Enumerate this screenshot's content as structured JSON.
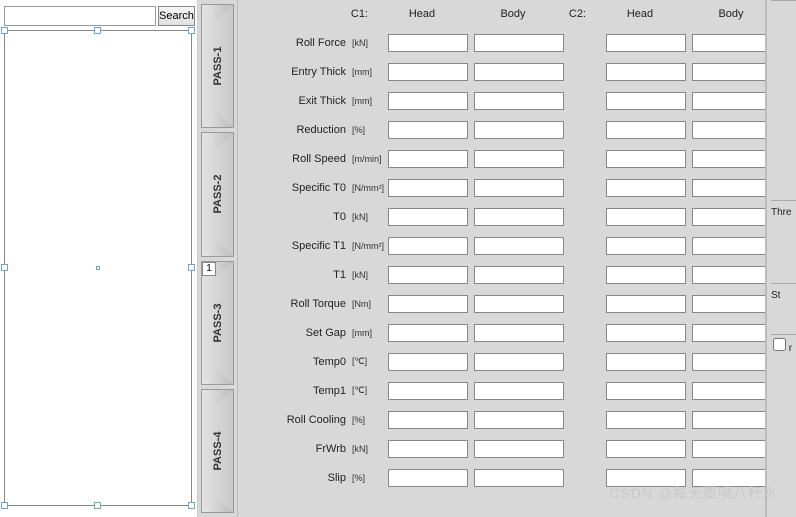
{
  "search": {
    "btn_label": "Search",
    "placeholder": ""
  },
  "page_indicator": "1",
  "pass_tabs": [
    "PASS-1",
    "PASS-2",
    "PASS-3",
    "PASS-4"
  ],
  "columns": {
    "c1": "C1:",
    "c2": "C2:",
    "head": "Head",
    "body": "Body"
  },
  "rows": [
    {
      "label": "Roll Force",
      "unit": "[kN]"
    },
    {
      "label": "Entry Thick",
      "unit": "[mm]"
    },
    {
      "label": "Exit Thick",
      "unit": "[mm]"
    },
    {
      "label": "Reduction",
      "unit": "[%]"
    },
    {
      "label": "Roll Speed",
      "unit": "[m/min]"
    },
    {
      "label": "Specific T0",
      "unit": "[N/mm²]"
    },
    {
      "label": "T0",
      "unit": "[kN]"
    },
    {
      "label": "Specific T1",
      "unit": "[N/mm²]"
    },
    {
      "label": "T1",
      "unit": "[kN]"
    },
    {
      "label": "Roll Torque",
      "unit": "[Nm]"
    },
    {
      "label": "Set Gap",
      "unit": "[mm]"
    },
    {
      "label": "Temp0",
      "unit": "[℃]"
    },
    {
      "label": "Temp1",
      "unit": "[℃]"
    },
    {
      "label": "Roll Cooling",
      "unit": "[%]"
    },
    {
      "label": "FrWrb",
      "unit": "[kN]"
    },
    {
      "label": "Slip",
      "unit": "[%]"
    }
  ],
  "right": {
    "thre": "Thre",
    "st": "St",
    "checkbox_label": "r"
  },
  "watermark": "CSDN @每天要喝八杯水"
}
